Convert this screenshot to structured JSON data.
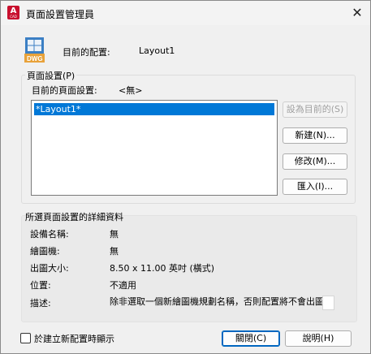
{
  "window": {
    "title": "頁面設置管理員",
    "app_icon_letter": "A",
    "app_icon_sub": "CAD",
    "close_glyph": "✕"
  },
  "header": {
    "icon_label": "DWG",
    "current_layout_label": "目前的配置:",
    "current_layout_value": "Layout1"
  },
  "page_setups": {
    "group_title": "頁面設置(P)",
    "current_setup_label": "目前的頁面設置:",
    "current_setup_value": "<無>",
    "list_items": [
      "*Layout1*"
    ],
    "buttons": {
      "set_current": "設為目前的(S)",
      "new": "新建(N)...",
      "modify": "修改(M)...",
      "import": "匯入(I)..."
    }
  },
  "details": {
    "group_title": "所選頁面設置的詳細資料",
    "rows": [
      {
        "label": "設備名稱:",
        "value": "無"
      },
      {
        "label": "繪圖機:",
        "value": "無"
      },
      {
        "label": "出圖大小:",
        "value": "8.50 x 11.00 英吋 (橫式)"
      },
      {
        "label": "位置:",
        "value": "不適用"
      },
      {
        "label": "描述:",
        "value": "除非選取一個新繪圖機規劃名稱，否則配置將不會出圖。"
      }
    ]
  },
  "footer": {
    "checkbox_label": "於建立新配置時顯示",
    "checkbox_checked": false,
    "close_button": "關閉(C)",
    "help_button": "說明(H)"
  },
  "colors": {
    "selection": "#0078d7",
    "app_icon": "#c8102e",
    "dialog_bg": "#f0f0f0"
  }
}
